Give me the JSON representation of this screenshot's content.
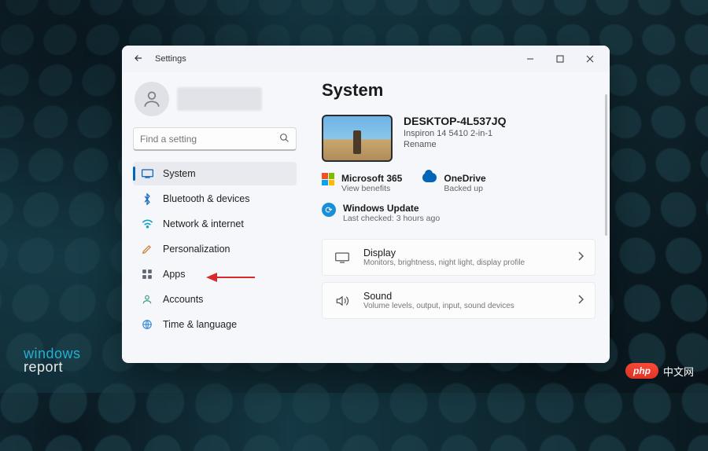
{
  "window": {
    "title": "Settings",
    "page_title": "System"
  },
  "search": {
    "placeholder": "Find a setting"
  },
  "sidebar": {
    "items": [
      {
        "label": "System",
        "icon": "system-icon",
        "active": true
      },
      {
        "label": "Bluetooth & devices",
        "icon": "bluetooth-icon",
        "active": false
      },
      {
        "label": "Network & internet",
        "icon": "network-icon",
        "active": false
      },
      {
        "label": "Personalization",
        "icon": "personalization-icon",
        "active": false
      },
      {
        "label": "Apps",
        "icon": "apps-icon",
        "active": false
      },
      {
        "label": "Accounts",
        "icon": "accounts-icon",
        "active": false
      },
      {
        "label": "Time & language",
        "icon": "time-language-icon",
        "active": false
      }
    ]
  },
  "device": {
    "name": "DESKTOP-4L537JQ",
    "model": "Inspiron 14 5410 2-in-1",
    "rename_label": "Rename"
  },
  "status": {
    "microsoft365": {
      "label": "Microsoft 365",
      "sub": "View benefits"
    },
    "onedrive": {
      "label": "OneDrive",
      "sub": "Backed up"
    },
    "windows_update": {
      "label": "Windows Update",
      "sub": "Last checked: 3 hours ago"
    }
  },
  "cards": {
    "display": {
      "title": "Display",
      "sub": "Monitors, brightness, night light, display profile"
    },
    "sound": {
      "title": "Sound",
      "sub": "Volume levels, output, input, sound devices"
    }
  },
  "annotation": {
    "target": "Apps"
  },
  "watermarks": {
    "left_line1": "windows",
    "left_line2": "report",
    "right_badge": "php",
    "right_text": "中文网"
  }
}
